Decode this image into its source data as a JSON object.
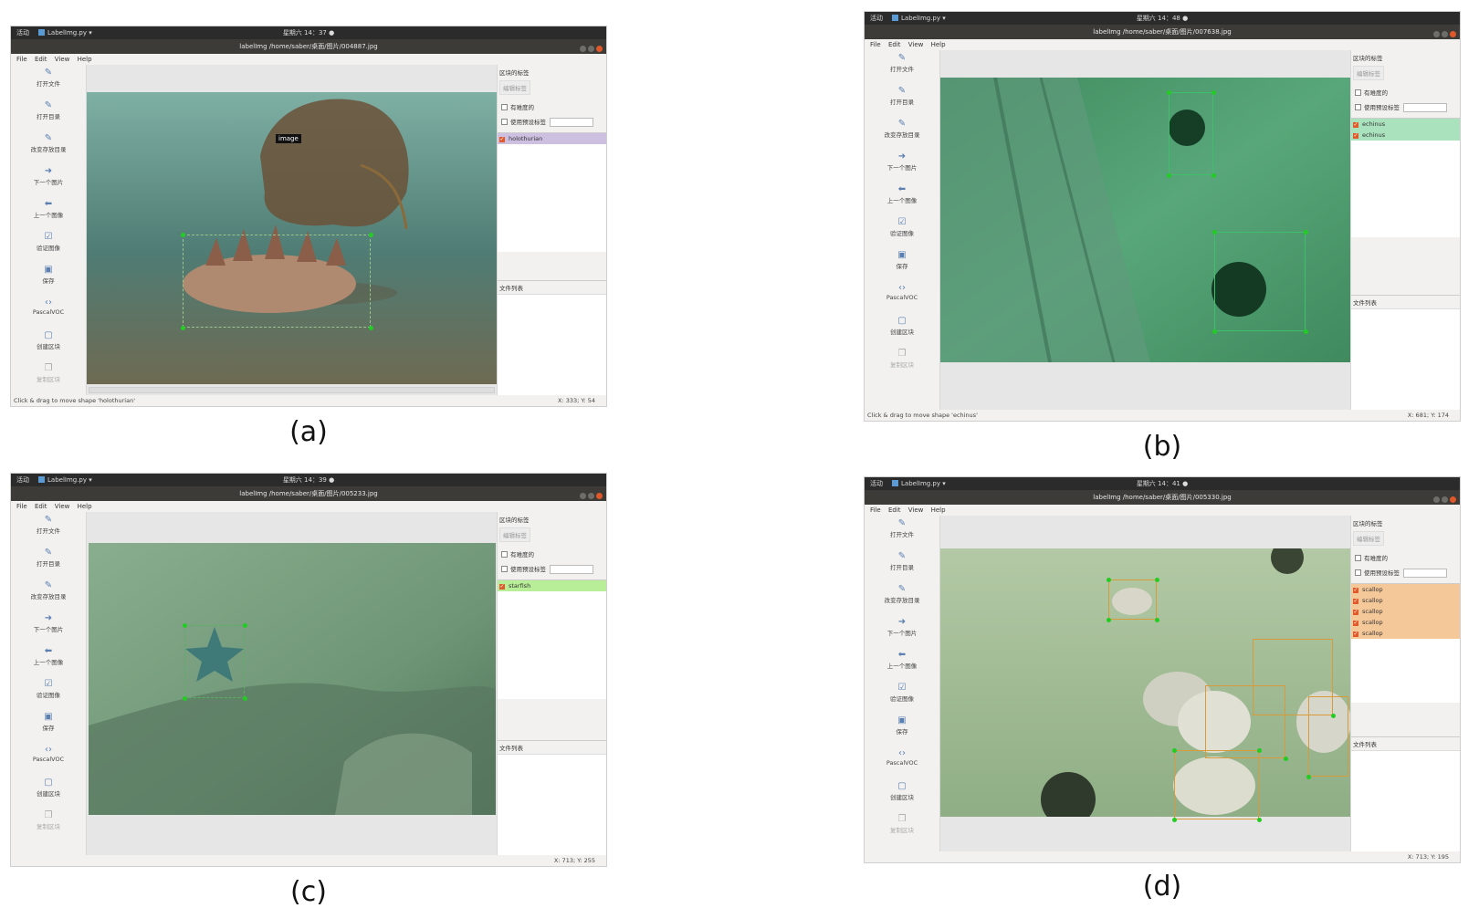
{
  "common": {
    "app_label": "LabelImg.py ▾",
    "activities_label": "活动",
    "menus": [
      "File",
      "Edit",
      "View",
      "Help"
    ],
    "tools": [
      "打开文件",
      "打开目录",
      "改变存放目录",
      "下一个图片",
      "上一个图像",
      "验证图像",
      "保存",
      "PascalVOC",
      "创建区块",
      "复制区块"
    ],
    "tool_icons": [
      "open-file-icon",
      "open-dir-icon",
      "change-save-dir-icon",
      "next-image-icon",
      "prev-image-icon",
      "verify-icon",
      "save-icon",
      "format-icon",
      "create-box-icon",
      "duplicate-box-icon"
    ],
    "dock_title": "区块的标签",
    "edit_label_btn": "编辑标签",
    "difficult_label": "有难度的",
    "use_default_label": "使用预设标签",
    "file_list_title": "文件列表"
  },
  "panels": [
    {
      "caption": "(a)",
      "clock": "星期六 14：37 ●",
      "title": "labelImg /home/saber/桌面/图片/004887.jpg",
      "photo_colors": [
        "#5f8c86",
        "#3d6b66",
        "#7a7058"
      ],
      "labels": [
        "holothurian"
      ],
      "label_bg": "#cdbfe0",
      "box_color": "#7fb96a",
      "tooltip": "image",
      "status": "Click & drag to move shape 'holothurian'",
      "coord": "X: 333; Y: 54"
    },
    {
      "caption": "(b)",
      "clock": "星期六 14：48 ●",
      "title": "labelImg /home/saber/桌面/图片/007638.jpg",
      "photo_colors": [
        "#4a9b6e",
        "#2f7250",
        "#6fb78c"
      ],
      "labels": [
        "echinus",
        "echinus"
      ],
      "label_bg": "#a9e2bc",
      "box_color": "#3fbf6a",
      "status": "Click & drag to move shape 'echinus'",
      "coord": "X: 681; Y: 174"
    },
    {
      "caption": "(c)",
      "clock": "星期六 14：39 ●",
      "title": "labelImg /home/saber/桌面/图片/005233.jpg",
      "photo_colors": [
        "#6f9a7c",
        "#4f7a5e",
        "#8fb396"
      ],
      "labels": [
        "starfish"
      ],
      "label_bg": "#b8ee98",
      "box_color": "#3aa84a",
      "status": "",
      "coord": "X: 713; Y: 255"
    },
    {
      "caption": "(d)",
      "clock": "星期六 14：41 ●",
      "title": "labelImg /home/saber/桌面/图片/005330.jpg",
      "photo_colors": [
        "#93b58e",
        "#7aa27a",
        "#b9cfa9"
      ],
      "labels": [
        "scallop",
        "scallop",
        "scallop",
        "scallop",
        "scallop"
      ],
      "label_bg": "#f5c89a",
      "box_color": "#d99a3a",
      "status": "",
      "coord": "X: 713; Y: 195"
    }
  ]
}
